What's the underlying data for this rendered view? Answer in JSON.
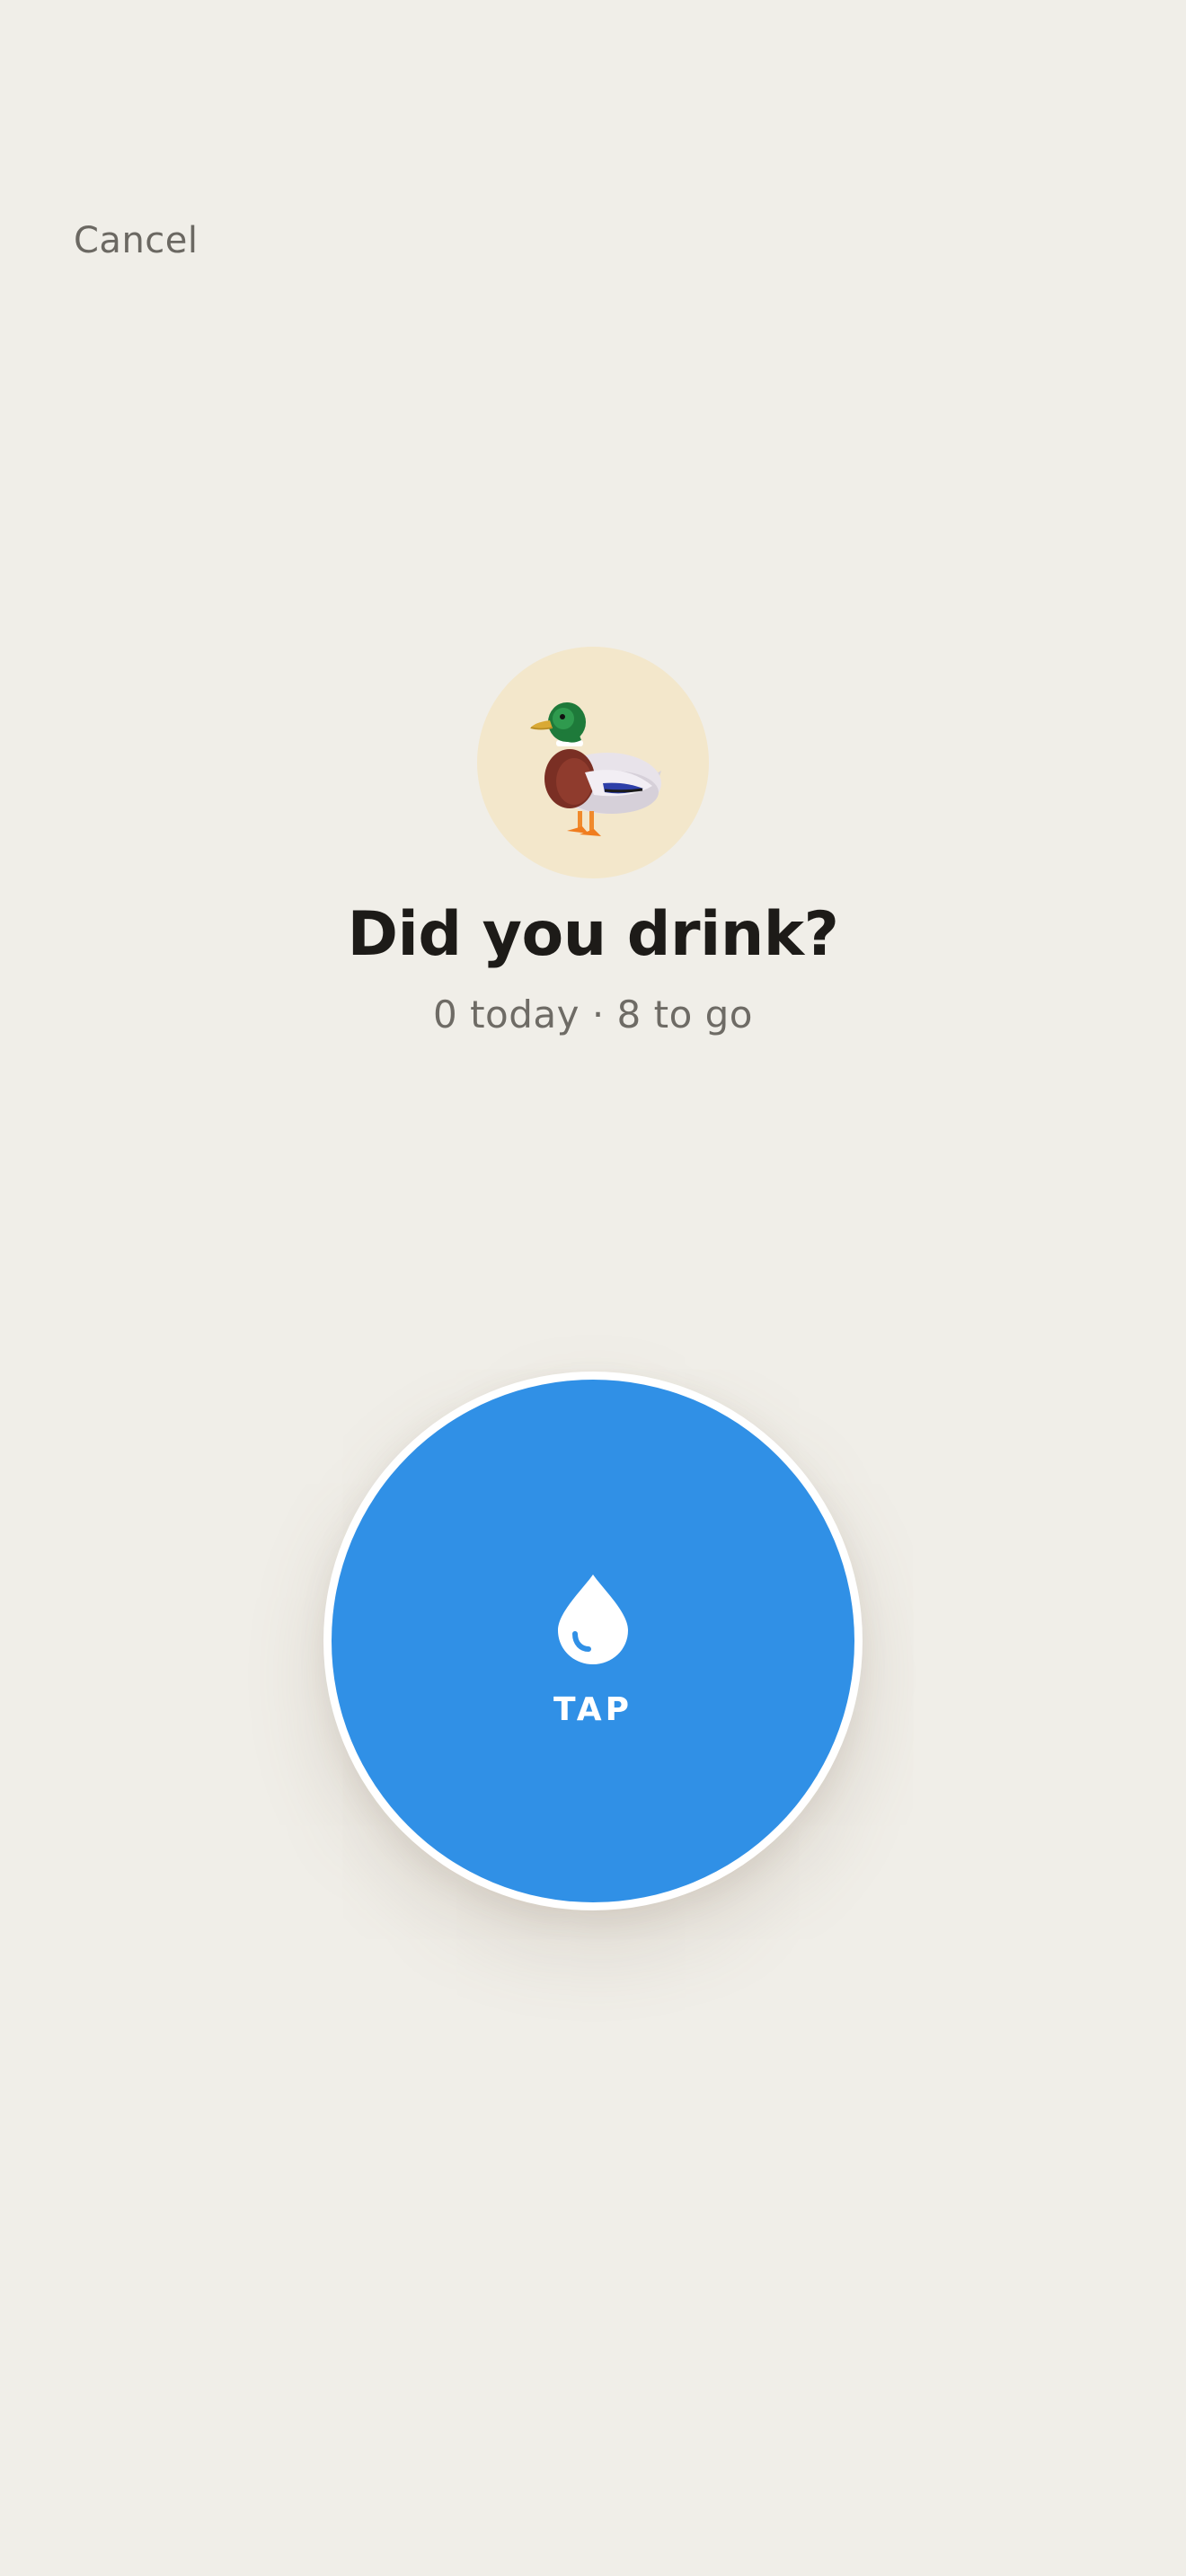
{
  "header": {
    "cancel_label": "Cancel"
  },
  "mascot": {
    "icon": "duck-icon"
  },
  "prompt": {
    "title": "Did you drink?",
    "subtitle": "0 today · 8 to go"
  },
  "tap_button": {
    "label": "TAP",
    "icon": "water-drop-icon",
    "color": "#3090e6"
  },
  "colors": {
    "background": "#f0eee8",
    "avatar_bg": "#f3e7cb",
    "title": "#1d1b18",
    "muted_text": "#6e6b65"
  }
}
